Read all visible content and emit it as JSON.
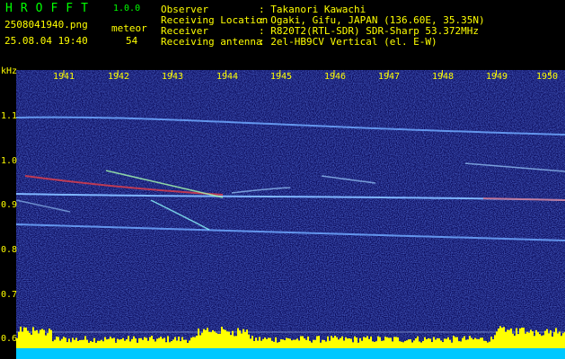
{
  "header": {
    "logo": "HROFFT",
    "version": "1.0.0",
    "filename": "2508041940.png",
    "meteor_label": "meteor",
    "datetime": "25.08.04 19:40",
    "meteor_count": "54",
    "info": [
      {
        "label": "Observer",
        "value": ": Takanori Kawachi"
      },
      {
        "label": "Receiving Location",
        "value": ": Ogaki, Gifu, JAPAN (136.60E, 35.35N)"
      },
      {
        "label": "Receiver",
        "value": ": R820T2(RTL-SDR) SDR-Sharp 53.372MHz"
      },
      {
        "label": "Receiving antenna",
        "value": ": 2el-HB9CV Vertical (el. E-W)"
      }
    ]
  },
  "axes": {
    "y_unit": "kHz",
    "y_ticks": [
      "1.1",
      "1.0",
      "0.9",
      "0.8",
      "0.7",
      "0.6"
    ],
    "x_ticks": [
      "1941",
      "1942",
      "1943",
      "1944",
      "1945",
      "1946",
      "1947",
      "1948",
      "1949",
      "1950"
    ]
  },
  "colors": {
    "logo": "#00ff00",
    "labels": "#ffff00",
    "background": "#0a0a5a",
    "trace": "#7fb6ff",
    "hot": "#ff4040",
    "power": "#ffff00",
    "power_base": "#00c8ff"
  }
}
